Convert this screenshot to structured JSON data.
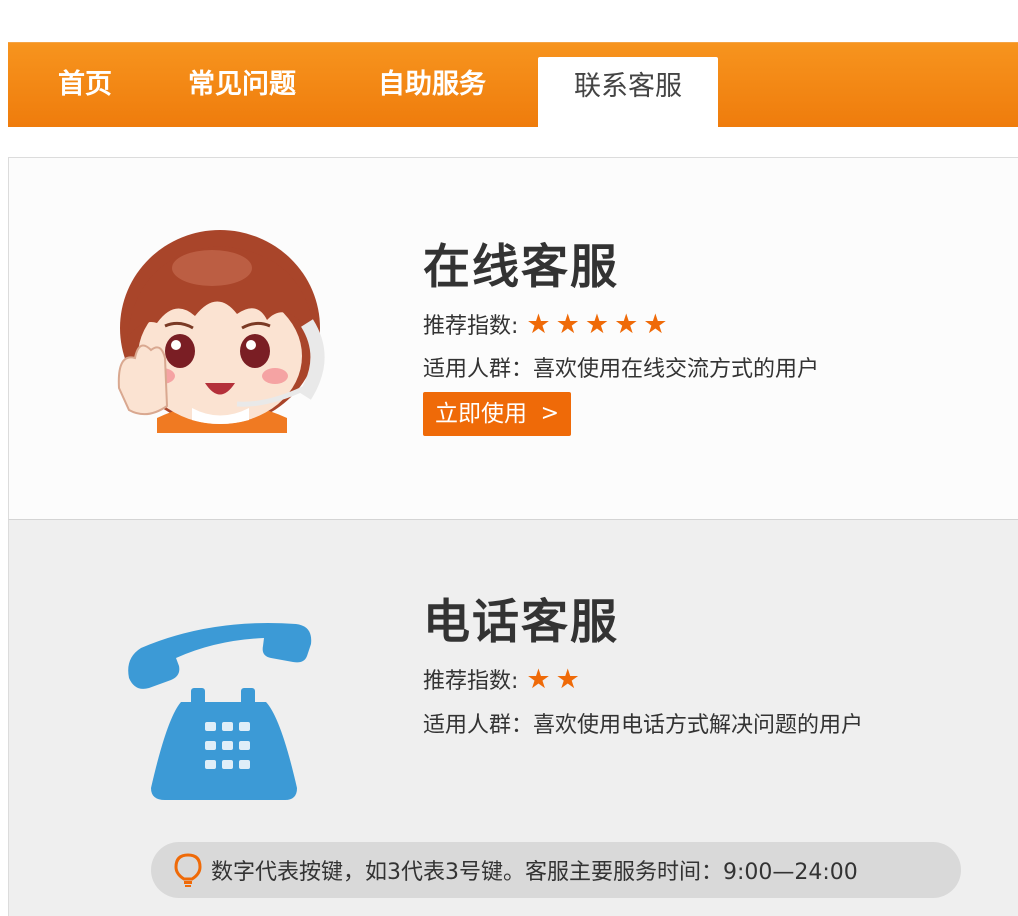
{
  "nav": {
    "items": [
      {
        "label": "首页"
      },
      {
        "label": "常见问题"
      },
      {
        "label": "自助服务"
      },
      {
        "label": "联系客服",
        "active": true
      }
    ]
  },
  "online": {
    "title": "在线客服",
    "rating_label": "推荐指数:",
    "rating": 5,
    "audience_label": "适用人群：",
    "audience": "喜欢使用在线交流方式的用户",
    "button_label": "立即使用",
    "button_icon": "chevron-right-icon"
  },
  "phone": {
    "title": "电话客服",
    "rating_label": "推荐指数:",
    "rating": 2,
    "audience_label": "适用人群：",
    "audience": "喜欢使用电话方式解决问题的用户",
    "notice": "数字代表按键，如3代表3号键。客服主要服务时间：9:00—24:00",
    "notice_icon": "lightbulb-icon"
  },
  "colors": {
    "brand_orange": "#f7941e",
    "button_orange": "#ef6a08",
    "phone_blue": "#3c9ad6"
  }
}
